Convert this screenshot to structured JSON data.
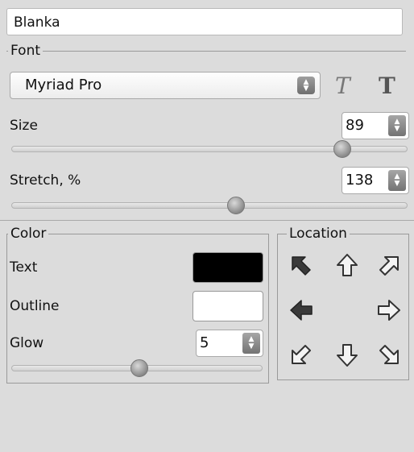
{
  "name_field": {
    "value": "Blanka"
  },
  "font_group": {
    "legend": "Font",
    "font_family": "Myriad Pro",
    "italic_label": "T",
    "bold_label": "T",
    "size": {
      "label": "Size",
      "value": "89",
      "slider_fraction": 0.85
    },
    "stretch": {
      "label": "Stretch, %",
      "value": "138",
      "slider_fraction": 0.57
    }
  },
  "color_group": {
    "legend": "Color",
    "text": {
      "label": "Text",
      "color": "#000000"
    },
    "outline": {
      "label": "Outline",
      "color": "#ffffff"
    },
    "glow": {
      "label": "Glow",
      "value": "5",
      "slider_fraction": 0.51
    }
  },
  "location_group": {
    "legend": "Location",
    "selected": "top-left"
  }
}
